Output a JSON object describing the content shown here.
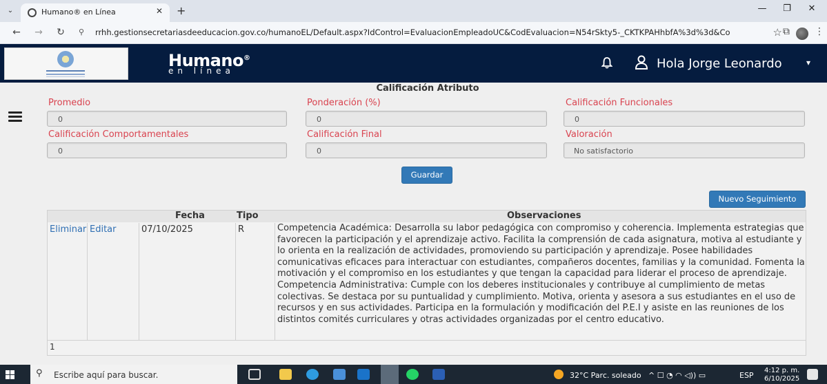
{
  "browser": {
    "tab_title": "Humano® en Línea",
    "url": "rrhh.gestionsecretariasdeeducacion.gov.co/humanoEL/Default.aspx?IdControl=EvaluacionEmpleadoUC&CodEvaluacion=N54rSkty5-_CKTKPAHhbfA%3d%3d&CodE..."
  },
  "header": {
    "brand_main": "Humano",
    "brand_reg": "®",
    "brand_sub": "en línea",
    "greeting": "Hola Jorge Leonardo"
  },
  "form": {
    "section_title": "Calificación Atributo",
    "fields": [
      {
        "label": "Promedio",
        "value": "0"
      },
      {
        "label": "Ponderación (%)",
        "value": "0"
      },
      {
        "label": "Calificación Funcionales",
        "value": "0"
      },
      {
        "label": "Calificación Comportamentales",
        "value": "0"
      },
      {
        "label": "Calificación Final",
        "value": "0"
      },
      {
        "label": "Valoración",
        "value": "No satisfactorio"
      }
    ],
    "save_label": "Guardar",
    "new_followup_label": "Nuevo Seguimiento"
  },
  "table": {
    "headers": {
      "fecha": "Fecha",
      "tipo": "Tipo",
      "observaciones": "Observaciones"
    },
    "rows": [
      {
        "delete_label": "Eliminar",
        "edit_label": "Editar",
        "fecha": "07/10/2025",
        "tipo": "R",
        "observaciones": "Competencia Académica: Desarrolla su labor pedagógica con compromiso y coherencia. Implementa estrategias que favorecen la participación y el aprendizaje activo. Facilita la comprensión de cada asignatura, motiva al estudiante y lo orienta en la realización de actividades, promoviendo su participación y aprendizaje. Posee habilidades comunicativas eficaces para interactuar con estudiantes, compañeros docentes, familias y la comunidad. Fomenta la motivación y el compromiso en los estudiantes y que tengan la capacidad para liderar el proceso de aprendizaje. Competencia Administrativa: Cumple con los deberes institucionales y contribuye al cumplimiento de metas colectivas. Se destaca por su puntualidad y cumplimiento. Motiva, orienta y asesora a sus estudiantes en el uso de recursos y en sus actividades. Participa en la formulación y modificación del P.E.I y asiste en las reuniones de los distintos comités curriculares y otras actividades organizadas por el centro educativo."
      }
    ],
    "pager": "1"
  },
  "taskbar": {
    "search_placeholder": "Escribe aquí para buscar.",
    "weather": "32°C  Parc. soleado",
    "language": "ESP",
    "time": "4:12 p. m.",
    "date": "6/10/2025"
  }
}
